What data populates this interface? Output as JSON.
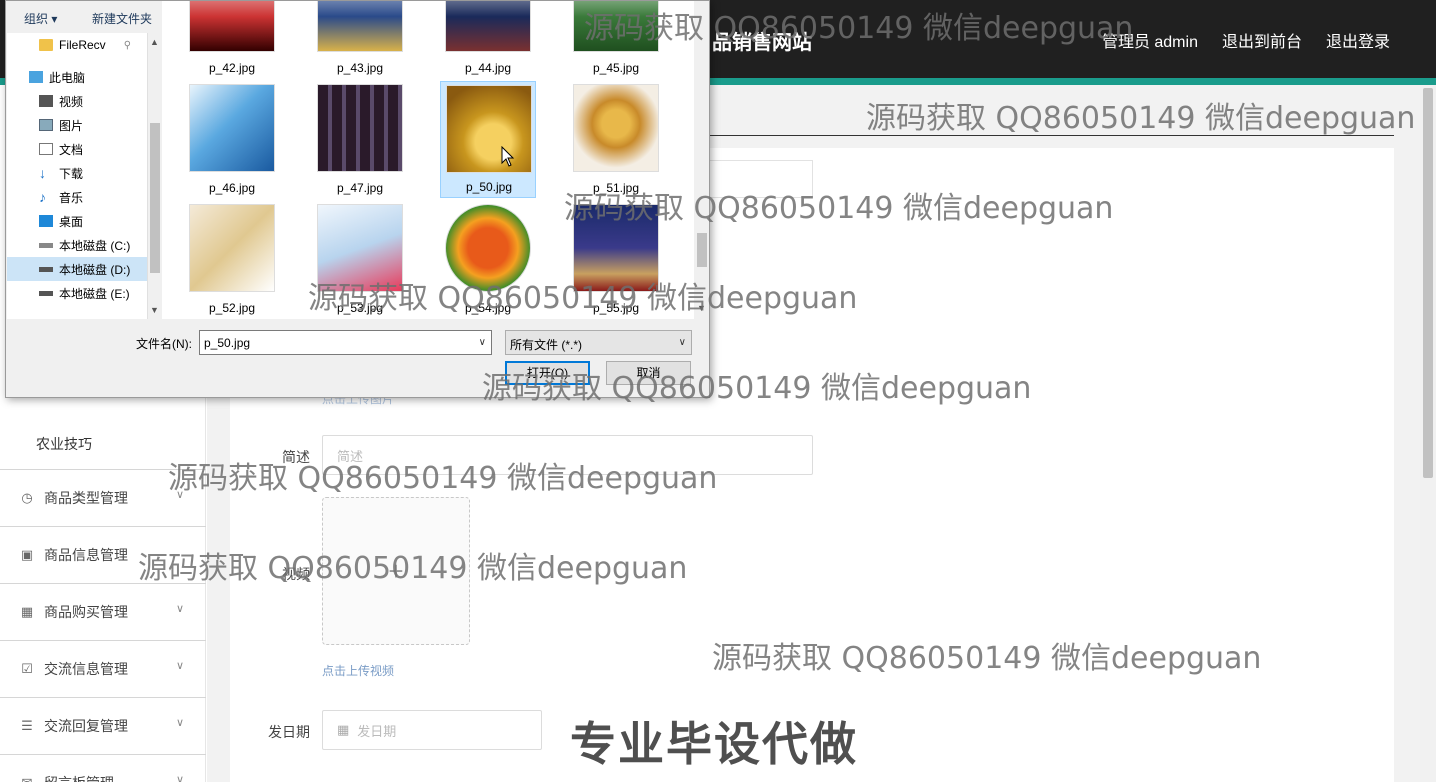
{
  "app": {
    "site_title": "品销售网站",
    "nav": [
      "管理员 admin",
      "退出到前台",
      "退出登录"
    ]
  },
  "sidebar": {
    "sub_item": "农业技巧",
    "items": [
      {
        "label": "商品类型管理",
        "icon": "clock-icon"
      },
      {
        "label": "商品信息管理",
        "icon": "clipboard-icon"
      },
      {
        "label": "商品购买管理",
        "icon": "grid-icon"
      },
      {
        "label": "交流信息管理",
        "icon": "checklist-icon"
      },
      {
        "label": "交流回复管理",
        "icon": "list-icon"
      },
      {
        "label": "留言板管理",
        "icon": "message-icon"
      }
    ]
  },
  "form": {
    "upload_image_link": "点击上传图片",
    "summary_label": "简述",
    "summary_placeholder": "简述",
    "video_label": "视频",
    "video_plus": "+",
    "upload_video_link": "点击上传视频",
    "date_label": "发日期",
    "date_placeholder": "发日期"
  },
  "dialog": {
    "toolbar": {
      "organize": "组织 ▾",
      "new_folder": "新建文件夹",
      "help": "?"
    },
    "nav_items": [
      {
        "label": "FileRecv",
        "icon": "folder-icon",
        "indent": 1
      },
      {
        "label": "此电脑",
        "icon": "computer-icon",
        "indent": 0
      },
      {
        "label": "视频",
        "icon": "video-icon",
        "indent": 1
      },
      {
        "label": "图片",
        "icon": "picture-icon",
        "indent": 1
      },
      {
        "label": "文档",
        "icon": "document-icon",
        "indent": 1
      },
      {
        "label": "下载",
        "icon": "download-icon",
        "indent": 1
      },
      {
        "label": "音乐",
        "icon": "music-icon",
        "indent": 1
      },
      {
        "label": "桌面",
        "icon": "desktop-icon",
        "indent": 1
      },
      {
        "label": "本地磁盘 (C:)",
        "icon": "drive-icon",
        "indent": 1
      },
      {
        "label": "本地磁盘 (D:)",
        "icon": "drive-icon",
        "indent": 1,
        "selected": true
      },
      {
        "label": "本地磁盘 (E:)",
        "icon": "drive-icon",
        "indent": 1
      }
    ],
    "files": [
      {
        "name": "p_42.jpg"
      },
      {
        "name": "p_43.jpg"
      },
      {
        "name": "p_44.jpg"
      },
      {
        "name": "p_45.jpg"
      },
      {
        "name": "p_46.jpg"
      },
      {
        "name": "p_47.jpg"
      },
      {
        "name": "p_50.jpg",
        "selected": true
      },
      {
        "name": "p_51.jpg"
      },
      {
        "name": "p_52.jpg"
      },
      {
        "name": "p_53.jpg"
      },
      {
        "name": "p_54.jpg"
      },
      {
        "name": "p_55.jpg"
      }
    ],
    "filename_label": "文件名(N):",
    "filename_value": "p_50.jpg",
    "filter_value": "所有文件 (*.*)",
    "open_button": "打开(O)",
    "cancel_button": "取消"
  },
  "watermarks": {
    "text": "源码获取 QQ86050149 微信deepguan",
    "promo": "专业毕设代做"
  },
  "colors": {
    "topbar": "#202020",
    "accent": "#1a9c8c",
    "selection": "#cce8ff",
    "dialog_bg": "#f0f0f0"
  }
}
